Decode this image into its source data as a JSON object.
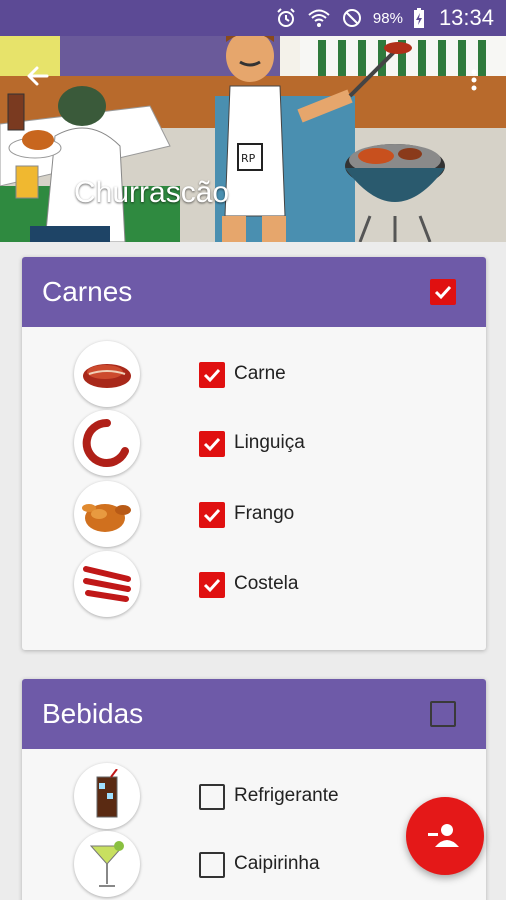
{
  "status_bar": {
    "battery": "98%",
    "time": "13:34"
  },
  "header": {
    "title": "Churrascão",
    "back_icon": "arrow-left-icon",
    "menu_icon": "more-vert-icon"
  },
  "cards": [
    {
      "title": "Carnes",
      "checked": true,
      "items": [
        {
          "label": "Carne",
          "icon": "steak-icon",
          "checked": true
        },
        {
          "label": "Linguiça",
          "icon": "sausage-icon",
          "checked": true
        },
        {
          "label": "Frango",
          "icon": "chicken-icon",
          "checked": true
        },
        {
          "label": "Costela",
          "icon": "ribs-icon",
          "checked": true
        }
      ]
    },
    {
      "title": "Bebidas",
      "checked": false,
      "items": [
        {
          "label": "Refrigerante",
          "icon": "soda-glass-icon",
          "checked": false
        },
        {
          "label": "Caipirinha",
          "icon": "cocktail-glass-icon",
          "checked": false
        }
      ]
    }
  ],
  "fab": {
    "icon": "person-remove-icon"
  },
  "colors": {
    "primary": "#6e5aa8",
    "status_bar": "#5c4a95",
    "accent": "#e41818"
  }
}
